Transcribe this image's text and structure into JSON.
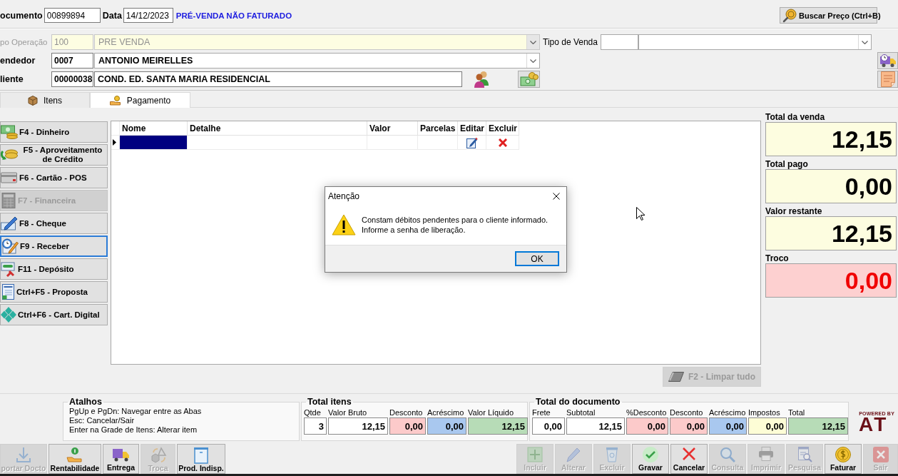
{
  "header": {
    "document_label": "ocumento",
    "document_number": "00899894",
    "date_label": "Data",
    "date": "14/12/2023",
    "status": "PRÉ-VENDA NÃO FATURADO",
    "price_button": "Buscar Preço (Ctrl+B)"
  },
  "operation": {
    "label": "po Operação",
    "code": "100",
    "name": "PRE VENDA",
    "disabled": true
  },
  "sale_type": {
    "label": "Tipo de Venda"
  },
  "seller": {
    "label": "endedor",
    "code": "0007",
    "name": "ANTONIO MEIRELLES"
  },
  "client": {
    "label": "liente",
    "code": "00000038",
    "name": "COND. ED. SANTA MARIA RESIDENCIAL"
  },
  "tabs": [
    {
      "label": "Itens",
      "selected": false
    },
    {
      "label": "Pagamento",
      "selected": true
    }
  ],
  "payment_buttons": [
    {
      "label": "F4 - Dinheiro",
      "disabled": false,
      "focused": false
    },
    {
      "label": "F5 - Aproveitamento de Crédito",
      "disabled": false,
      "focused": false
    },
    {
      "label": "F6 - Cartão - POS",
      "disabled": false,
      "focused": false
    },
    {
      "label": "F7 - Financeira",
      "disabled": true,
      "focused": false
    },
    {
      "label": "F8 - Cheque",
      "disabled": false,
      "focused": false
    },
    {
      "label": "F9 - Receber",
      "disabled": false,
      "focused": true
    },
    {
      "label": "F11 - Depósito",
      "disabled": false,
      "focused": false
    },
    {
      "label": "Ctrl+F5 - Proposta",
      "disabled": false,
      "focused": false
    },
    {
      "label": "Ctrl+F6 - Cart. Digital",
      "disabled": false,
      "focused": false
    }
  ],
  "payments_table": {
    "columns": [
      "Nome",
      "Detalhe",
      "Valor",
      "Parcelas",
      "Editar",
      "Excluir"
    ],
    "rows": [
      {
        "selected": true
      }
    ]
  },
  "clear_button": {
    "label": "F2 - Limpar tudo",
    "disabled": true
  },
  "totals": [
    {
      "label": "Total da venda",
      "value": "12,15",
      "kind": "amount"
    },
    {
      "label": "Total pago",
      "value": "0,00",
      "kind": "amount"
    },
    {
      "label": "Valor restante",
      "value": "12,15",
      "kind": "amount"
    },
    {
      "label": "Troco",
      "value": "0,00",
      "kind": "change"
    }
  ],
  "dialog": {
    "title": "Atenção",
    "message": "Constam débitos pendentes para o cliente informado.\nInforme a senha de liberação.",
    "button": "OK"
  },
  "shortcuts": {
    "title": "Atalhos",
    "lines": [
      "PgUp e PgDn: Navegar entre as Abas",
      "Esc: Cancelar/Sair",
      "Enter na Grade de Itens: Alterar item"
    ]
  },
  "item_totals": {
    "title": "Total itens",
    "fields": [
      {
        "label": "Qtde",
        "value": "3",
        "color": "#ffffff"
      },
      {
        "label": "Valor Bruto",
        "value": "12,15",
        "color": "#ffffff"
      },
      {
        "label": "Desconto",
        "value": "0,00",
        "color": "#fccaca"
      },
      {
        "label": "Acréscimo",
        "value": "0,00",
        "color": "#a9c8ef"
      },
      {
        "label": "Valor Líquido",
        "value": "12,15",
        "color": "#b7dcb7"
      }
    ]
  },
  "document_totals": {
    "title": "Total do documento",
    "fields": [
      {
        "label": "Frete",
        "value": "0,00",
        "color": "#ffffff"
      },
      {
        "label": "Subtotal",
        "value": "12,15",
        "color": "#ffffff"
      },
      {
        "label": "%Desconto",
        "value": "0,00",
        "color": "#fccaca"
      },
      {
        "label": "Desconto",
        "value": "0,00",
        "color": "#fccaca"
      },
      {
        "label": "Acréscimo",
        "value": "0,00",
        "color": "#a9c8ef"
      },
      {
        "label": "Impostos",
        "value": "0,00",
        "color": "#fdfdd6"
      },
      {
        "label": "Total",
        "value": "12,15",
        "color": "#b7dcb7"
      }
    ]
  },
  "logo": {
    "tagline": "POWERED BY",
    "name": "AT"
  },
  "toolbar_left": [
    {
      "label": "portar Docto",
      "disabled": true
    },
    {
      "label": "Rentabilidade",
      "disabled": false
    },
    {
      "label": "Entrega",
      "disabled": false
    },
    {
      "label": "Troca",
      "disabled": true
    },
    {
      "label": "Prod. Indisp.",
      "disabled": false
    }
  ],
  "toolbar_right": [
    {
      "label": "Incluir",
      "disabled": true
    },
    {
      "label": "Alterar",
      "disabled": true
    },
    {
      "label": "Excluir",
      "disabled": true
    },
    {
      "label": "Gravar",
      "disabled": false
    },
    {
      "label": "Cancelar",
      "disabled": false
    },
    {
      "label": "Consulta",
      "disabled": true
    },
    {
      "label": "Imprimir",
      "disabled": true
    },
    {
      "label": "Pesquisa",
      "disabled": true
    },
    {
      "label": "Faturar",
      "disabled": false
    },
    {
      "label": "Sair",
      "disabled": true
    }
  ]
}
